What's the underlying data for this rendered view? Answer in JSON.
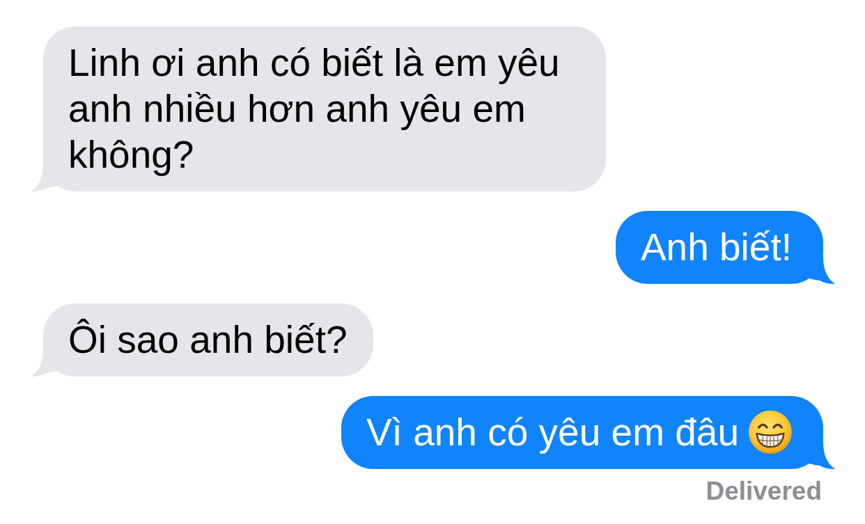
{
  "messages": [
    {
      "kind": "received",
      "text": "Linh ơi anh có biết là em yêu anh nhiều hơn anh yêu em không?"
    },
    {
      "kind": "sent",
      "text": "Anh biết!"
    },
    {
      "kind": "received",
      "text": "Ôi sao anh biết?"
    },
    {
      "kind": "sent",
      "text": "Vì anh có yêu em đâu",
      "emoji": {
        "kind": "grin"
      }
    }
  ],
  "status": "Delivered"
}
